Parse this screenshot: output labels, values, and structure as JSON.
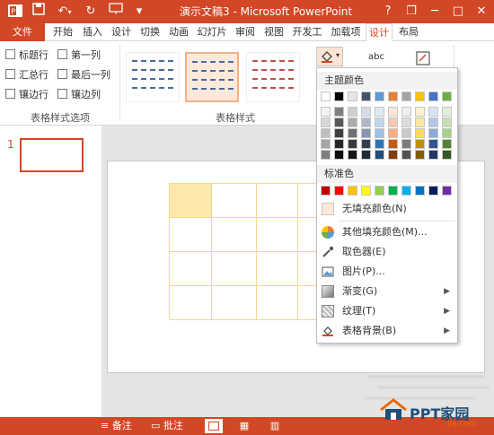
{
  "window": {
    "title": "演示文稿3 - Microsoft PowerPoint",
    "controls": {
      "help": "?",
      "restore": "❐",
      "minimize": "─",
      "maximize": "□",
      "close": "✕"
    }
  },
  "tabs": [
    {
      "label": "文件"
    },
    {
      "label": "开始"
    },
    {
      "label": "插入"
    },
    {
      "label": "设计"
    },
    {
      "label": "切换"
    },
    {
      "label": "动画"
    },
    {
      "label": "幻灯片"
    },
    {
      "label": "审阅"
    },
    {
      "label": "视图"
    },
    {
      "label": "开发工"
    },
    {
      "label": "加载项"
    },
    {
      "label": "设计"
    },
    {
      "label": "布局"
    }
  ],
  "table_style_options": {
    "group_label": "表格样式选项",
    "items": [
      {
        "label": "标题行",
        "checked": false
      },
      {
        "label": "第一列",
        "checked": false
      },
      {
        "label": "汇总行",
        "checked": false
      },
      {
        "label": "最后一列",
        "checked": false
      },
      {
        "label": "镶边行",
        "checked": false
      },
      {
        "label": "镶边列",
        "checked": false
      }
    ]
  },
  "table_styles": {
    "group_label": "表格样式"
  },
  "ribbon_right": {
    "wordart_label": "abc"
  },
  "slide_panel": {
    "slide_number": "1"
  },
  "dropdown": {
    "theme_colors_label": "主题颜色",
    "standard_colors_label": "标准色",
    "theme_top_row": [
      "#ffffff",
      "#000000",
      "#e7e6e6",
      "#44546a",
      "#5b9bd5",
      "#ed7d31",
      "#a5a5a5",
      "#ffc000",
      "#4472c4",
      "#70ad47"
    ],
    "theme_shades": [
      [
        "#f2f2f2",
        "#7f7f7f",
        "#d0cece",
        "#d6dce4",
        "#deebf6",
        "#fbe5d5",
        "#ededed",
        "#fff2cc",
        "#d9e2f3",
        "#e2efd9"
      ],
      [
        "#d8d8d8",
        "#595959",
        "#aeabab",
        "#adb9ca",
        "#bdd7ee",
        "#f7cbac",
        "#dbdbdb",
        "#fee599",
        "#b4c6e7",
        "#c5e0b3"
      ],
      [
        "#bfbfbf",
        "#3f3f3f",
        "#757070",
        "#8496b0",
        "#9dc3e6",
        "#f4b083",
        "#c9c9c9",
        "#ffd965",
        "#8eaadb",
        "#a8d08d"
      ],
      [
        "#a5a5a5",
        "#262626",
        "#3a3838",
        "#323f4f",
        "#2e75b5",
        "#c55a11",
        "#7b7b7b",
        "#bf9000",
        "#2f5496",
        "#538135"
      ],
      [
        "#7f7f7f",
        "#0c0c0c",
        "#171616",
        "#222a35",
        "#1f4e79",
        "#833c0b",
        "#525252",
        "#7f6000",
        "#1f3864",
        "#375623"
      ]
    ],
    "standard_colors": [
      "#c00000",
      "#ff0000",
      "#ffc000",
      "#ffff00",
      "#92d050",
      "#00b050",
      "#00b0f0",
      "#0070c0",
      "#002060",
      "#7030a0"
    ],
    "no_fill": "无填充颜色(N)",
    "more_colors": "其他填充颜色(M)...",
    "eyedropper": "取色器(E)",
    "picture": "图片(P)...",
    "gradient": "渐变(G)",
    "texture": "纹理(T)",
    "table_background": "表格背景(B)"
  },
  "statusbar": {
    "notes": "备注",
    "comments": "批注"
  },
  "watermark": {
    "brand": "PPT家园",
    "domain": "jia.com"
  }
}
